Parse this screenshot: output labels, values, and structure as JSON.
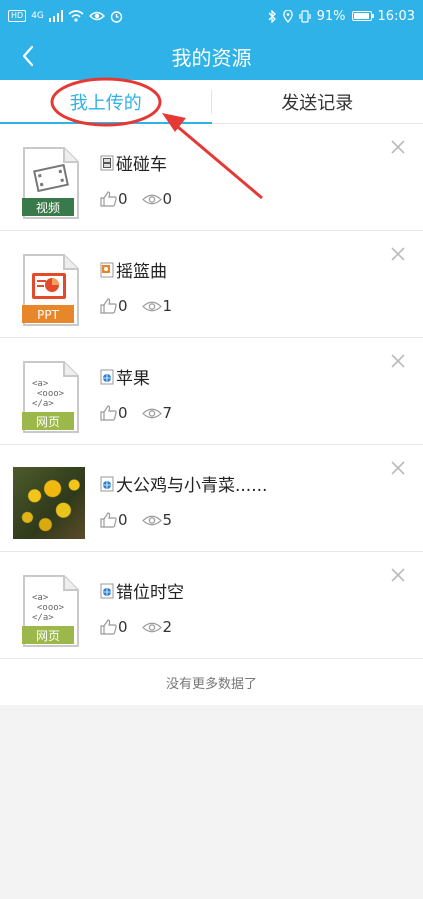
{
  "status_bar": {
    "left_badges": [
      "HD",
      "4G"
    ],
    "battery": "91%",
    "time": "16:03"
  },
  "header": {
    "title": "我的资源",
    "back_icon": "chevron-left-icon"
  },
  "tabs": [
    {
      "label": "我上传的",
      "active": true
    },
    {
      "label": "发送记录",
      "active": false
    }
  ],
  "items": [
    {
      "title": "碰碰车",
      "likes": "0",
      "views": "0",
      "thumb_label": "视频",
      "thumb_type": "video",
      "file_type": "video"
    },
    {
      "title": "摇篮曲",
      "likes": "0",
      "views": "1",
      "thumb_label": "PPT",
      "thumb_type": "ppt",
      "file_type": "ppt"
    },
    {
      "title": "苹果",
      "likes": "0",
      "views": "7",
      "thumb_label": "网页",
      "thumb_type": "web",
      "file_type": "web"
    },
    {
      "title": "大公鸡与小青菜......",
      "likes": "0",
      "views": "5",
      "thumb_label": "",
      "thumb_type": "photo",
      "file_type": "web"
    },
    {
      "title": "错位时空",
      "likes": "0",
      "views": "2",
      "thumb_label": "网页",
      "thumb_type": "web",
      "file_type": "web"
    }
  ],
  "footer": {
    "no_more_text": "没有更多数据了"
  },
  "colors": {
    "accent": "#2fb2e8",
    "annotation_red": "#e53935",
    "video_badge": "#3a7a4a",
    "ppt_badge": "#e8862a",
    "web_badge": "#9cb84a"
  }
}
